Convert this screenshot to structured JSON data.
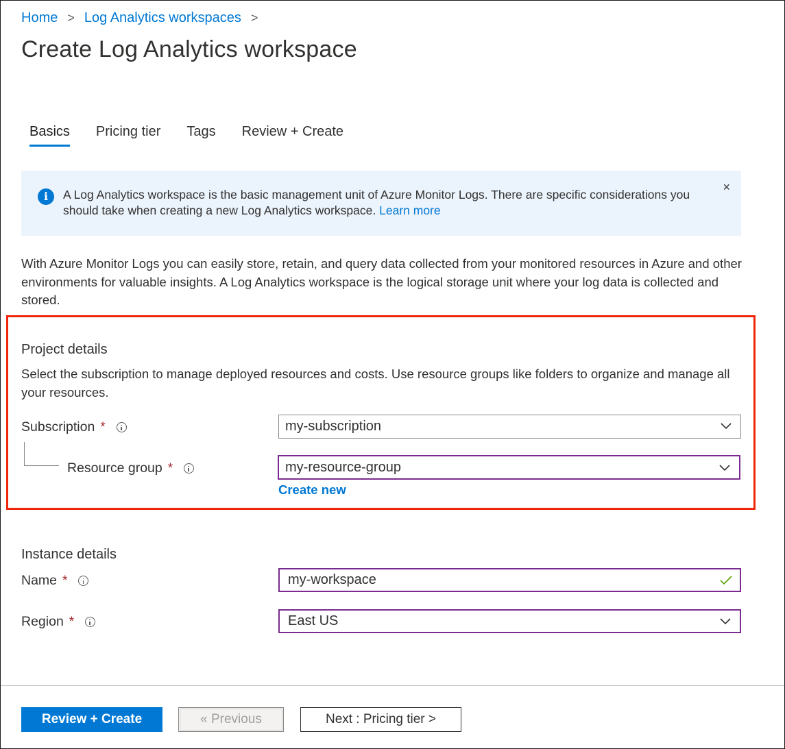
{
  "breadcrumb": {
    "items": [
      "Home",
      "Log Analytics workspaces"
    ],
    "separator": ">"
  },
  "page_title": "Create Log Analytics workspace",
  "tabs": [
    {
      "label": "Basics",
      "active": true
    },
    {
      "label": "Pricing tier",
      "active": false
    },
    {
      "label": "Tags",
      "active": false
    },
    {
      "label": "Review + Create",
      "active": false
    }
  ],
  "banner": {
    "icon": "info-icon",
    "text": "A Log Analytics workspace is the basic management unit of Azure Monitor Logs. There are specific considerations you should take when creating a new Log Analytics workspace.",
    "link": "Learn more",
    "close": "×"
  },
  "intro": "With Azure Monitor Logs you can easily store, retain, and query data collected from your monitored resources in Azure and other environments for valuable insights. A Log Analytics workspace is the logical storage unit where your log data is collected and stored.",
  "project_details": {
    "title": "Project details",
    "description": "Select the subscription to manage deployed resources and costs. Use resource groups like folders to organize and manage all your resources.",
    "subscription": {
      "label": "Subscription",
      "required": "*",
      "value": "my-subscription"
    },
    "resource_group": {
      "label": "Resource group",
      "required": "*",
      "value": "my-resource-group",
      "create_new": "Create new"
    }
  },
  "instance_details": {
    "title": "Instance details",
    "name": {
      "label": "Name",
      "required": "*",
      "value": "my-workspace"
    },
    "region": {
      "label": "Region",
      "required": "*",
      "value": "East US"
    }
  },
  "footer": {
    "review_create": "Review + Create",
    "previous": "« Previous",
    "next": "Next : Pricing tier >"
  },
  "colors": {
    "accent": "#0078d4",
    "highlight_border": "#f0250a",
    "required": "#a4262c",
    "focus_border": "#7a2b8f",
    "valid_check": "#57a300",
    "banner_bg": "#ebf3fc"
  }
}
